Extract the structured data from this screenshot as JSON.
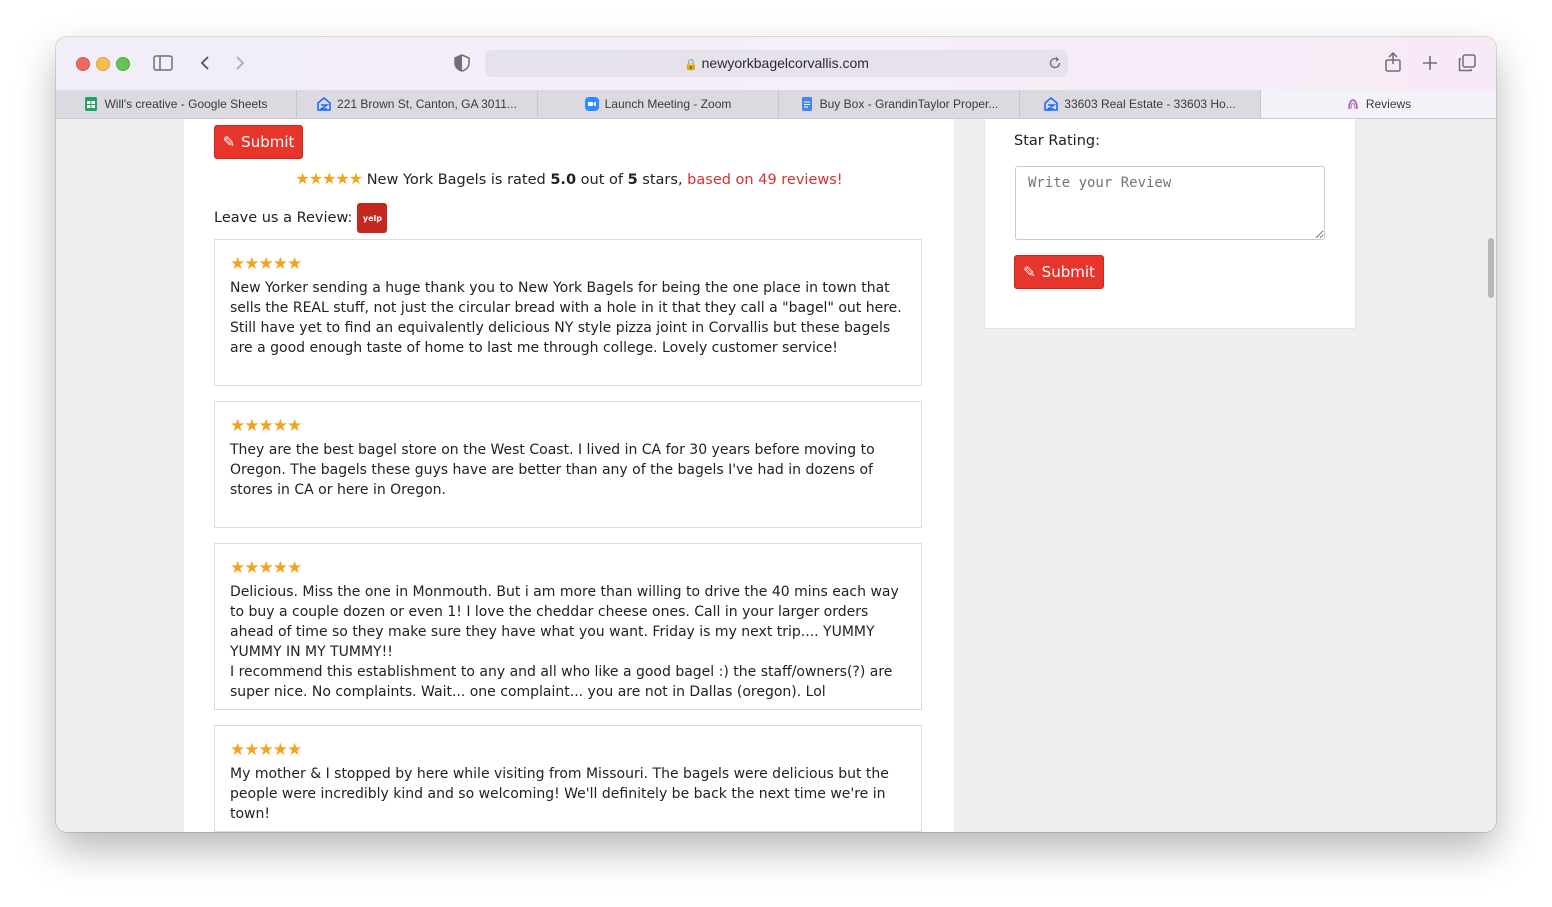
{
  "browser": {
    "url": "newyorkbagelcorvallis.com",
    "tabs": [
      {
        "label": "Will's creative - Google Sheets",
        "icon": "sheets-icon",
        "color": "#1fa463"
      },
      {
        "label": "221 Brown St, Canton, GA 3011...",
        "icon": "zillow-icon",
        "color": "#1b6bff"
      },
      {
        "label": "Launch Meeting - Zoom",
        "icon": "zoom-icon",
        "color": "#2d8cff"
      },
      {
        "label": "Buy Box - GrandinTaylor Proper...",
        "icon": "docs-icon",
        "color": "#4285f4"
      },
      {
        "label": "33603 Real Estate - 33603 Ho...",
        "icon": "zillow-icon",
        "color": "#1b6bff"
      },
      {
        "label": "Reviews",
        "icon": "reviews-icon",
        "color": "#9b59b6"
      }
    ]
  },
  "summary": {
    "submit_label": "Submit",
    "business": "New York Bagels",
    "rated_text": "is rated",
    "score": "5.0",
    "out_of": "out of",
    "max": "5",
    "stars_word": "stars,",
    "based_on": "based on 49 reviews!",
    "leave_label": "Leave us a Review:",
    "yelp_label": "yelp"
  },
  "reviews": [
    {
      "rating": 5,
      "text": "New Yorker sending a huge thank you to New York Bagels for being the one place in town that sells the REAL stuff, not just the circular bread with a hole in it that they call a \"bagel\" out here. Still have yet to find an equivalently delicious NY style pizza joint in Corvallis but these bagels are a good enough taste of home to last me through college. Lovely customer service!"
    },
    {
      "rating": 5,
      "text": "They are the best bagel store on the West Coast. I lived in CA for 30 years before moving to Oregon. The bagels these guys have are better than any of the bagels I've had in dozens of stores in CA or here in Oregon."
    },
    {
      "rating": 5,
      "text": "Delicious. Miss the one in Monmouth. But i am more than willing to drive the 40 mins each way to buy a couple dozen or even 1! I love the cheddar cheese ones. Call in your larger orders ahead of time so they make sure they have what you want. Friday is my next trip.... YUMMY YUMMY IN MY TUMMY!!",
      "text2": "I recommend this establishment to any and all who like a good bagel :) the staff/owners(?) are super nice. No complaints. Wait... one complaint... you are not in Dallas (oregon). Lol"
    },
    {
      "rating": 5,
      "text": "My mother & I stopped by here while visiting from Missouri. The bagels were delicious but the people were incredibly kind and so welcoming! We'll definitely be back the next time we're in town!"
    }
  ],
  "side_form": {
    "star_rating_label": "Star Rating:",
    "review_placeholder": "Write your Review",
    "submit_label": "Submit"
  },
  "colors": {
    "submit_red": "#e8352b",
    "star_gold": "#f2a41c",
    "link_red": "#d7312b"
  }
}
